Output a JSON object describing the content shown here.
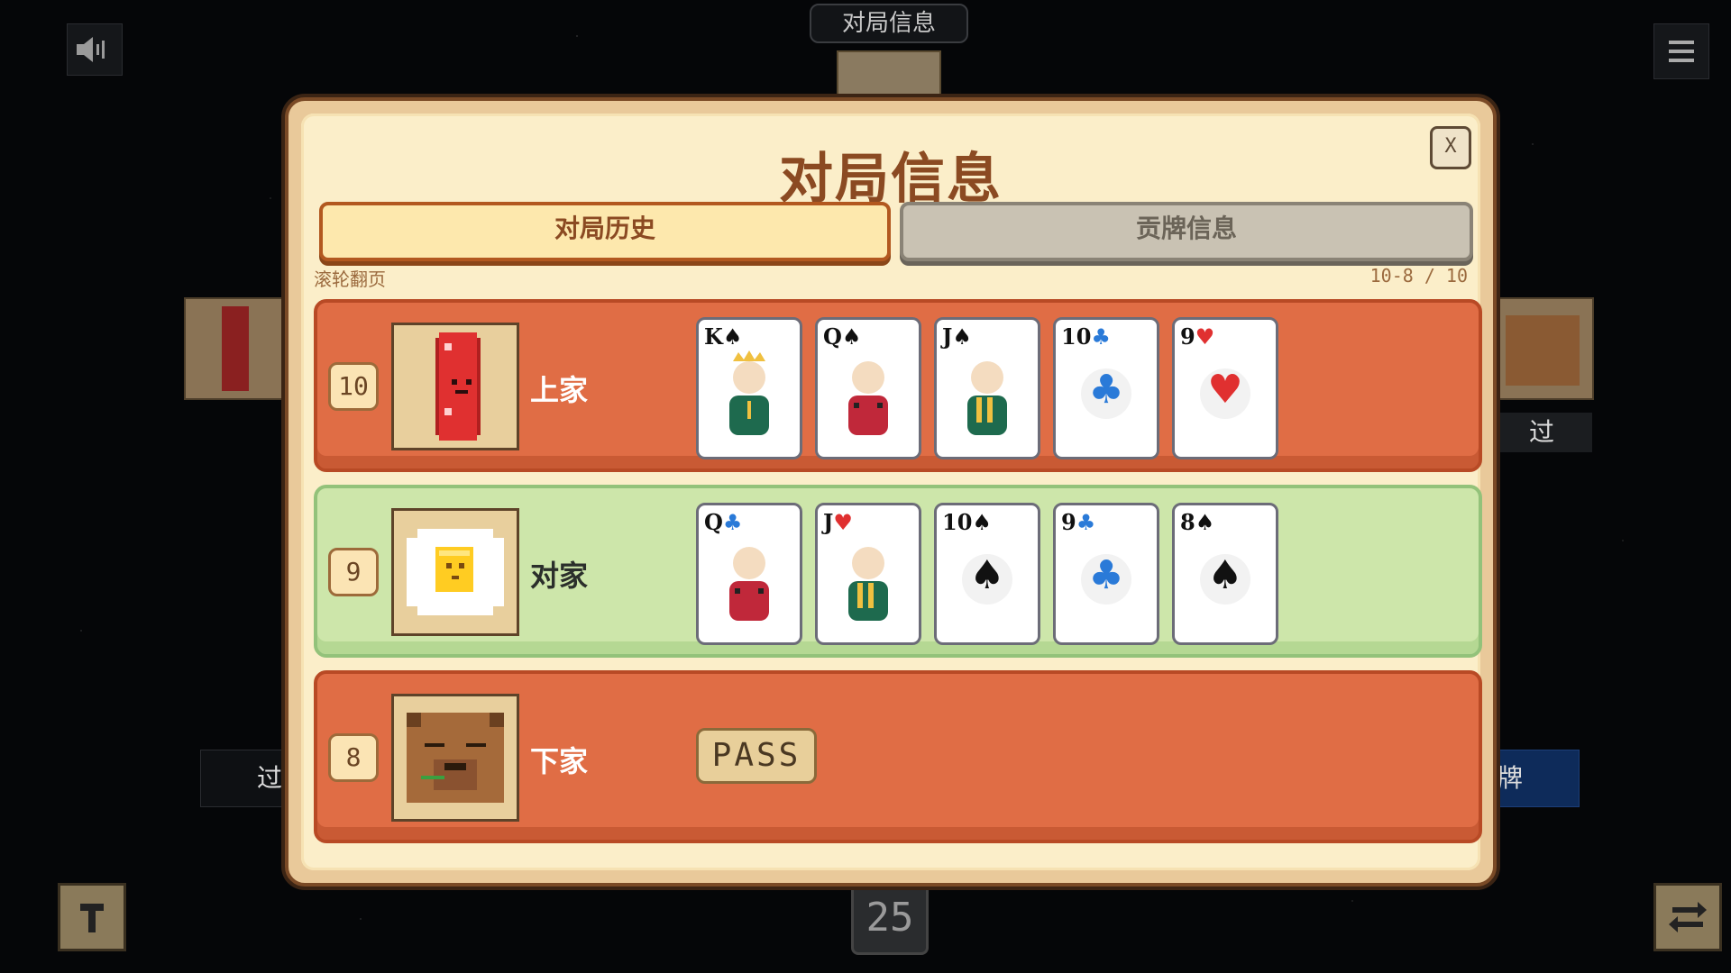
{
  "background": {
    "top_title": "对局信息",
    "right_label_top": "过",
    "right_label_bottom": "牌",
    "left_label_bottom": "过",
    "timer": "25"
  },
  "dialog": {
    "title": "对局信息",
    "close_label": "X",
    "tabs": [
      {
        "label": "对局历史",
        "active": true
      },
      {
        "label": "贡牌信息",
        "active": false
      }
    ],
    "hint": "滚轮翻页",
    "page_info": "10-8 / 10",
    "rows": [
      {
        "rank": "10",
        "name": "上家",
        "theme": "orange",
        "avatar": "red-sausage-avatar",
        "pass": false,
        "cards": [
          {
            "rank": "K",
            "suit": "♠",
            "suit_color": "#111111",
            "kind": "face-king"
          },
          {
            "rank": "Q",
            "suit": "♠",
            "suit_color": "#111111",
            "kind": "face-queen"
          },
          {
            "rank": "J",
            "suit": "♠",
            "suit_color": "#111111",
            "kind": "face-jack"
          },
          {
            "rank": "10",
            "suit": "♣",
            "suit_color": "#2a7ad8",
            "kind": "pip"
          },
          {
            "rank": "9",
            "suit": "♥",
            "suit_color": "#e03030",
            "kind": "pip"
          }
        ]
      },
      {
        "rank": "9",
        "name": "对家",
        "theme": "green",
        "avatar": "fried-egg-avatar",
        "pass": false,
        "cards": [
          {
            "rank": "Q",
            "suit": "♣",
            "suit_color": "#2a7ad8",
            "kind": "face-queen"
          },
          {
            "rank": "J",
            "suit": "♥",
            "suit_color": "#e03030",
            "kind": "face-jack"
          },
          {
            "rank": "10",
            "suit": "♠",
            "suit_color": "#111111",
            "kind": "pip"
          },
          {
            "rank": "9",
            "suit": "♣",
            "suit_color": "#2a7ad8",
            "kind": "pip"
          },
          {
            "rank": "8",
            "suit": "♠",
            "suit_color": "#111111",
            "kind": "pip"
          }
        ]
      },
      {
        "rank": "8",
        "name": "下家",
        "theme": "orange",
        "avatar": "capybara-avatar",
        "pass": true,
        "pass_label": "PASS",
        "cards": []
      }
    ]
  }
}
